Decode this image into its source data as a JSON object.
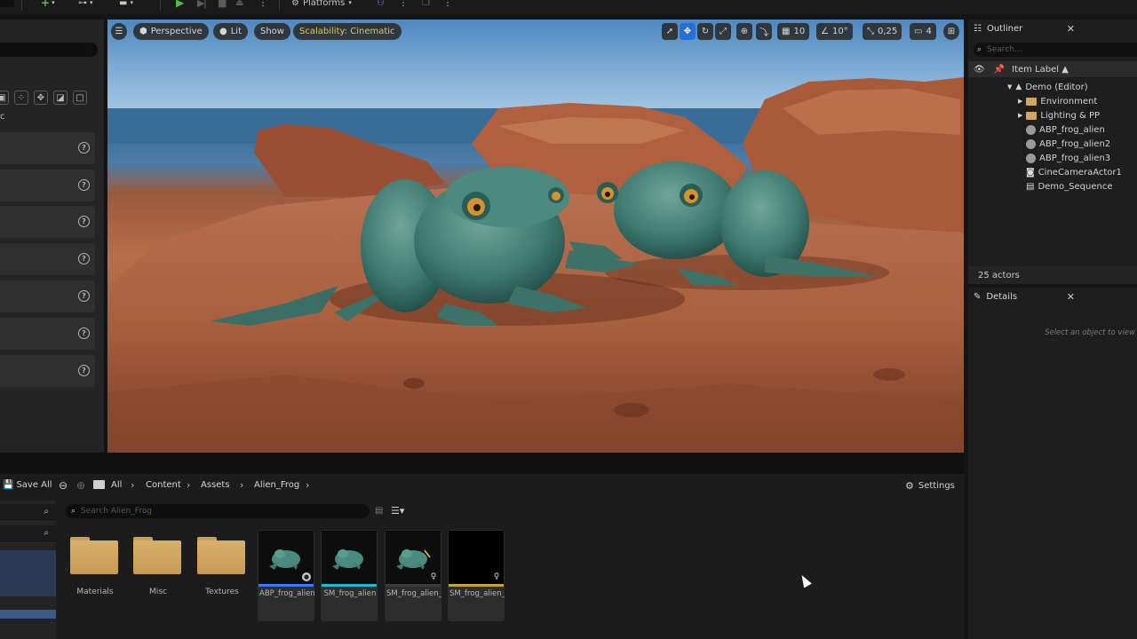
{
  "toolbar": {
    "platforms_label": "Platforms"
  },
  "viewport": {
    "perspective_label": "Perspective",
    "lit_label": "Lit",
    "show_label": "Show",
    "scalability_label": "Scalability: Cinematic",
    "grid_snap_value": "10",
    "rotation_snap_value": "10°",
    "scale_snap_value": "0,25",
    "camera_speed_value": "4"
  },
  "outliner": {
    "title": "Outliner",
    "search_placeholder": "Search...",
    "column_header": "Item Label ▲",
    "items": [
      {
        "label": "Demo (Editor)",
        "icon": "level-icon"
      },
      {
        "label": "Environment",
        "icon": "folder-icon"
      },
      {
        "label": "Lighting & PP",
        "icon": "folder-icon"
      },
      {
        "label": "ABP_frog_alien",
        "icon": "skeletal-mesh-icon"
      },
      {
        "label": "ABP_frog_alien2",
        "icon": "skeletal-mesh-icon"
      },
      {
        "label": "ABP_frog_alien3",
        "icon": "skeletal-mesh-icon"
      },
      {
        "label": "CineCameraActor1",
        "icon": "camera-icon"
      },
      {
        "label": "Demo_Sequence",
        "icon": "sequence-icon"
      }
    ],
    "actor_count": "25 actors"
  },
  "details": {
    "title": "Details",
    "empty_hint": "Select an object to view"
  },
  "content_browser": {
    "save_all_label": "Save All",
    "breadcrumbs": [
      "All",
      "Content",
      "Assets",
      "Alien_Frog"
    ],
    "settings_label": "Settings",
    "search_placeholder": "Search Alien_Frog",
    "folders": [
      "Materials",
      "Misc",
      "Textures"
    ],
    "assets": [
      {
        "label": "ABP_frog_alien",
        "strip_color": "#3a78ff"
      },
      {
        "label": "SM_frog_alien",
        "strip_color": "#22b8d0"
      },
      {
        "label": "SM_frog_alien_CtrlRig",
        "strip_color": "#3a3a3a"
      },
      {
        "label": "SM_frog_alien_PuppetRig",
        "strip_color": "#c8a23a"
      }
    ]
  },
  "colors": {
    "accent_blue": "#2a6dd6",
    "scalability_text": "#e8c547",
    "folder": "#d1a862"
  }
}
